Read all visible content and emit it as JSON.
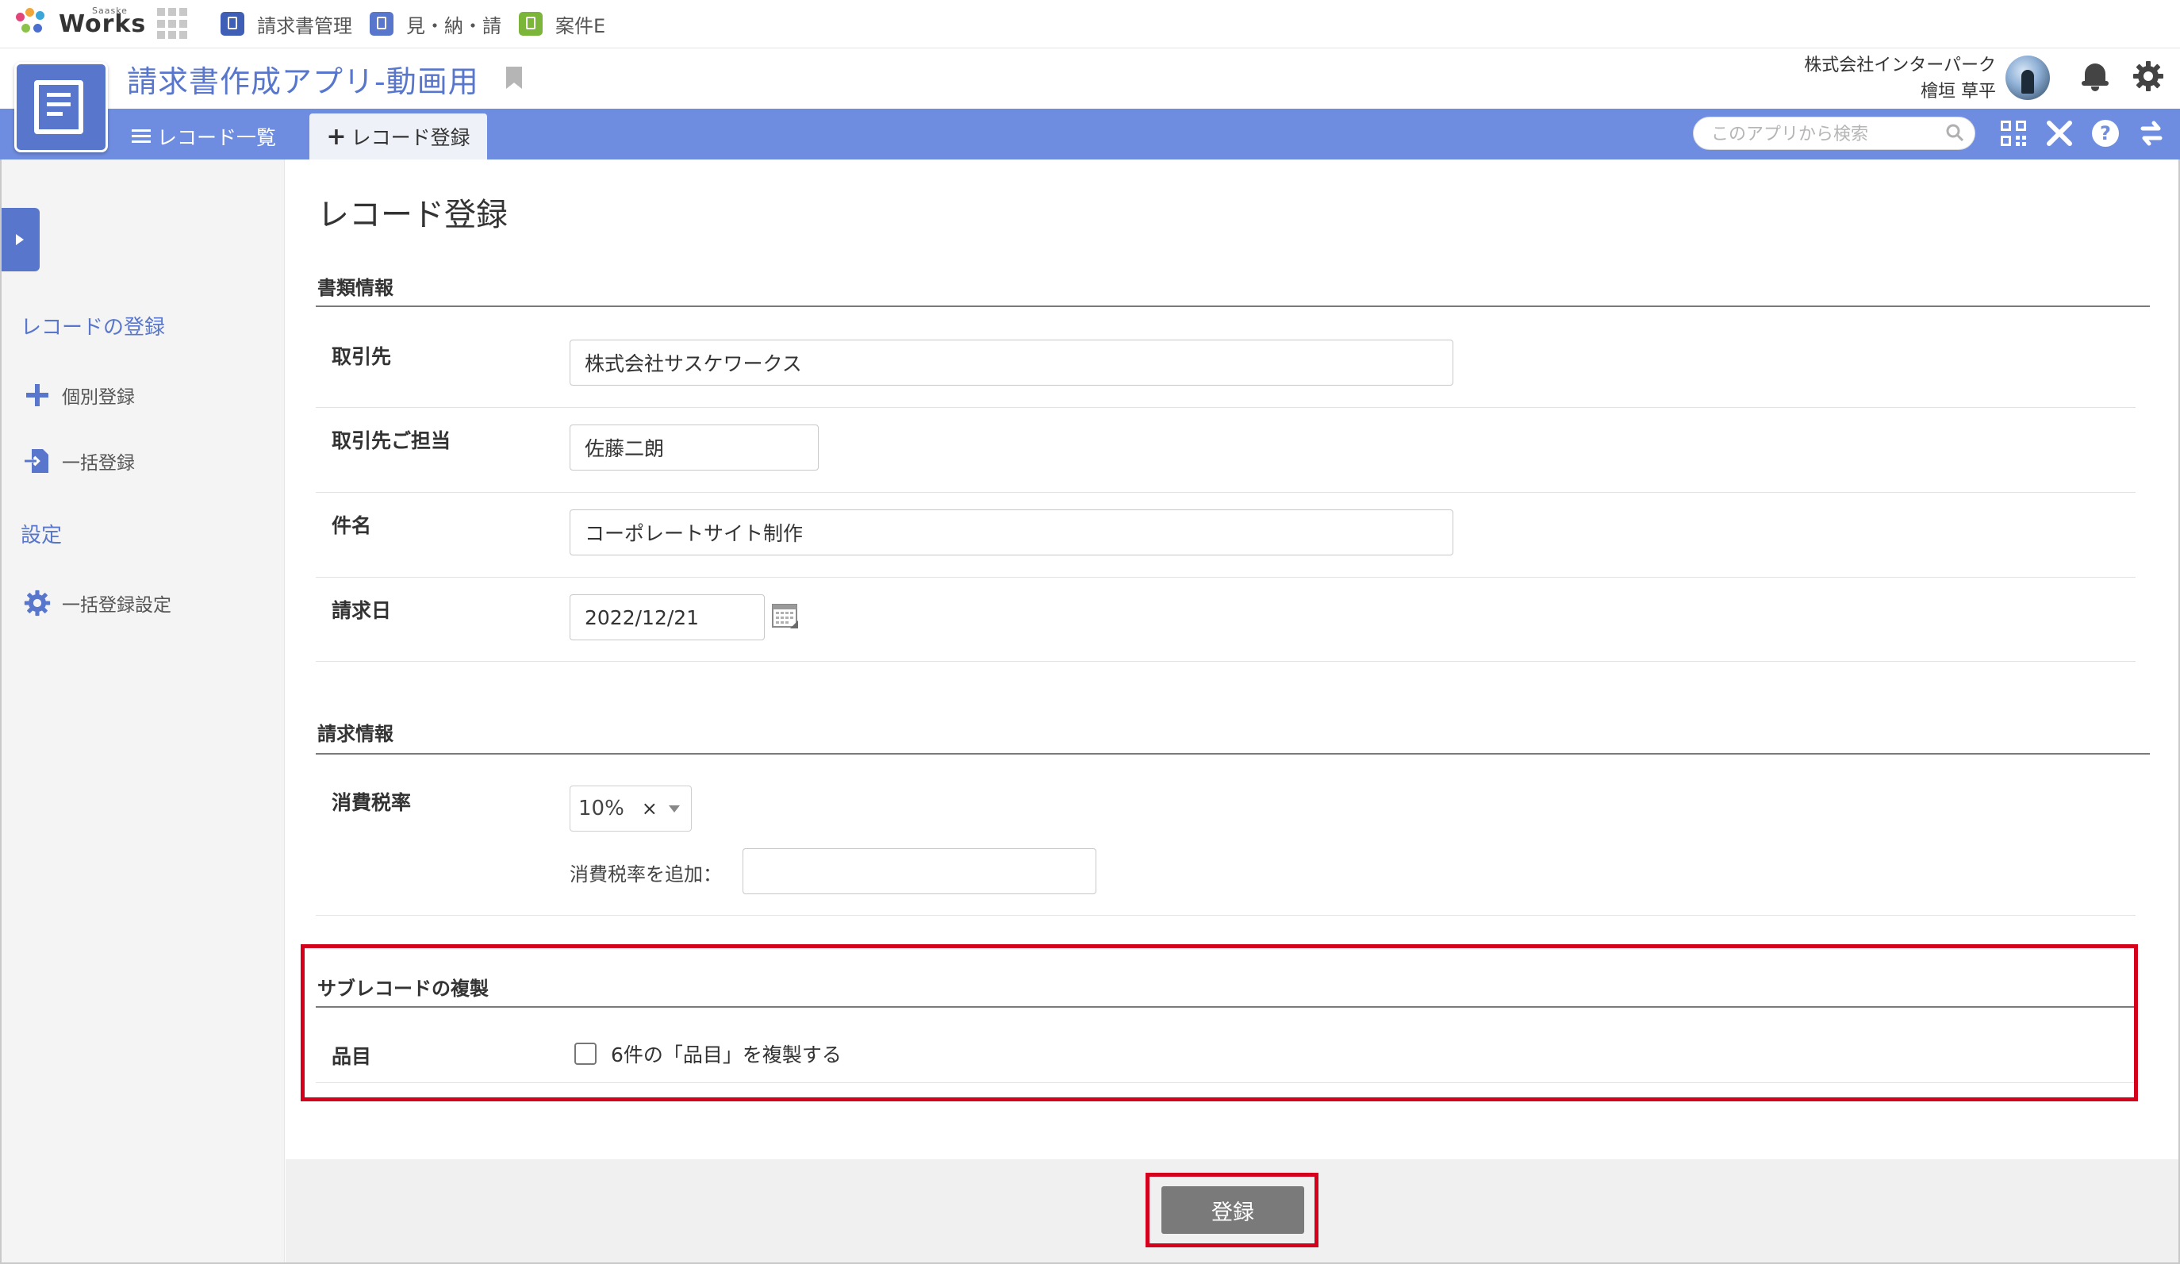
{
  "portal": {
    "brand_small": "Saaske",
    "brand": "Works",
    "links": [
      {
        "label": "請求書管理",
        "color": "#3e5fb5",
        "icon": "lock-doc-icon"
      },
      {
        "label": "見・納・請",
        "color": "#5877cc",
        "icon": "document-icon"
      },
      {
        "label": "案件E",
        "color": "#7bb53a",
        "icon": "document-icon"
      }
    ]
  },
  "app": {
    "title": "請求書作成アプリ-動画用",
    "accent": "#5877cc",
    "toolbar_color": "#6f8de0",
    "company": "株式会社インターパーク",
    "user_name": "檜垣 草平"
  },
  "toolbar": {
    "list_label": "レコード一覧",
    "new_label": "レコード登録",
    "search_placeholder": "このアプリから検索"
  },
  "sidebar": {
    "heading_register": "レコードの登録",
    "item_single": "個別登録",
    "item_bulk": "一括登録",
    "heading_settings": "設定",
    "item_bulk_settings": "一括登録設定"
  },
  "form": {
    "page_title": "レコード登録",
    "section_doc": "書類情報",
    "client_label": "取引先",
    "client_value": "株式会社サスケワークス",
    "contact_label": "取引先ご担当",
    "contact_value": "佐藤二朗",
    "subject_label": "件名",
    "subject_value": "コーポレートサイト制作",
    "date_label": "請求日",
    "date_value": "2022/12/21",
    "section_billing": "請求情報",
    "tax_label": "消費税率",
    "tax_value": "10%",
    "tax_clear": "×",
    "tax_add_label": "消費税率を追加：",
    "tax_add_value": "",
    "section_subrecord": "サブレコードの複製",
    "items_label": "品目",
    "duplicate_label": "6件の「品目」を複製する",
    "duplicate_checked": false
  },
  "footer": {
    "submit_label": "登録"
  },
  "highlight_color": "#d5001c"
}
